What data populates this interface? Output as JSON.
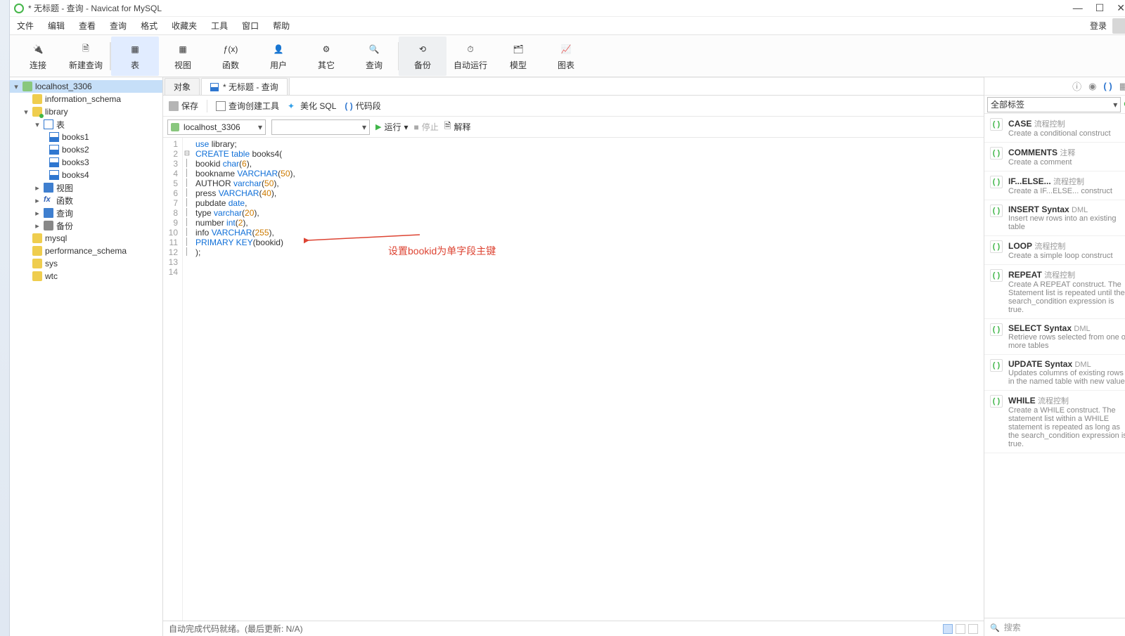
{
  "window": {
    "title": "* 无标题 - 查询 - Navicat for MySQL"
  },
  "win_controls": {
    "min": "—",
    "max": "☐",
    "close": "✕"
  },
  "menu": {
    "items": [
      "文件",
      "编辑",
      "查看",
      "查询",
      "格式",
      "收藏夹",
      "工具",
      "窗口",
      "帮助"
    ],
    "login": "登录"
  },
  "toolbar": {
    "items": [
      {
        "label": "连接",
        "icon": "plug"
      },
      {
        "label": "新建查询",
        "icon": "newq"
      },
      {
        "label": "表",
        "icon": "table",
        "active": true
      },
      {
        "label": "视图",
        "icon": "view"
      },
      {
        "label": "函数",
        "icon": "fx"
      },
      {
        "label": "用户",
        "icon": "user"
      },
      {
        "label": "其它",
        "icon": "other"
      },
      {
        "label": "查询",
        "icon": "query"
      },
      {
        "label": "备份",
        "icon": "backup",
        "grey": true
      },
      {
        "label": "自动运行",
        "icon": "auto"
      },
      {
        "label": "模型",
        "icon": "model"
      },
      {
        "label": "图表",
        "icon": "chart"
      }
    ]
  },
  "sidebar": {
    "conn": "localhost_3306",
    "dbs": [
      "information_schema"
    ],
    "library": {
      "name": "library",
      "tables_label": "表",
      "tables": [
        "books1",
        "books2",
        "books3",
        "books4"
      ],
      "view": "视图",
      "fx": "函数",
      "query": "查询",
      "backup": "备份"
    },
    "other_dbs": [
      "mysql",
      "performance_schema",
      "sys",
      "wtc"
    ]
  },
  "tabs": {
    "objects": "对象",
    "current": "* 无标题 - 查询"
  },
  "querybar": {
    "save": "保存",
    "builder": "查询创建工具",
    "beautify": "美化 SQL",
    "snippet": "代码段"
  },
  "connbar": {
    "conn": "localhost_3306",
    "run": "运行",
    "stop": "停止",
    "explain": "解释"
  },
  "code_lines": [
    [
      {
        "t": "use ",
        "c": "kw"
      },
      {
        "t": "library;"
      }
    ],
    [
      {
        "t": "CREATE table ",
        "c": "kw"
      },
      {
        "t": "books4("
      }
    ],
    [
      {
        "t": "bookid "
      },
      {
        "t": "char",
        "c": "kw"
      },
      {
        "t": "("
      },
      {
        "t": "6",
        "c": "num"
      },
      {
        "t": "),"
      }
    ],
    [
      {
        "t": "bookname "
      },
      {
        "t": "VARCHAR",
        "c": "kw"
      },
      {
        "t": "("
      },
      {
        "t": "50",
        "c": "num"
      },
      {
        "t": "),"
      }
    ],
    [
      {
        "t": "AUTHOR "
      },
      {
        "t": "varchar",
        "c": "kw"
      },
      {
        "t": "("
      },
      {
        "t": "50",
        "c": "num"
      },
      {
        "t": "),"
      }
    ],
    [
      {
        "t": "press "
      },
      {
        "t": "VARCHAR",
        "c": "kw"
      },
      {
        "t": "("
      },
      {
        "t": "40",
        "c": "num"
      },
      {
        "t": "),"
      }
    ],
    [
      {
        "t": "pubdate "
      },
      {
        "t": "date",
        "c": "kw"
      },
      {
        "t": ","
      }
    ],
    [
      {
        "t": "type "
      },
      {
        "t": "varchar",
        "c": "kw"
      },
      {
        "t": "("
      },
      {
        "t": "20",
        "c": "num"
      },
      {
        "t": "),"
      }
    ],
    [
      {
        "t": "number "
      },
      {
        "t": "int",
        "c": "kw"
      },
      {
        "t": "("
      },
      {
        "t": "2",
        "c": "num"
      },
      {
        "t": "),"
      }
    ],
    [
      {
        "t": "info "
      },
      {
        "t": "VARCHAR",
        "c": "kw"
      },
      {
        "t": "("
      },
      {
        "t": "255",
        "c": "num"
      },
      {
        "t": "),"
      }
    ],
    [
      {
        "t": "PRIMARY KEY",
        "c": "kw"
      },
      {
        "t": "(bookid)"
      }
    ],
    [
      {
        "t": ");"
      }
    ],
    [],
    []
  ],
  "annotation": "设置bookid为单字段主键",
  "status": "自动完成代码就绪。(最后更新: N/A)",
  "right": {
    "filter": "全部标签",
    "snippets": [
      {
        "name": "CASE",
        "sub": "流程控制",
        "desc": "Create a conditional construct"
      },
      {
        "name": "COMMENTS",
        "sub": "注释",
        "desc": "Create a comment"
      },
      {
        "name": "IF...ELSE...",
        "sub": "流程控制",
        "desc": "Create a IF...ELSE... construct"
      },
      {
        "name": "INSERT Syntax",
        "sub": "DML",
        "desc": "Insert new rows into an existing table"
      },
      {
        "name": "LOOP",
        "sub": "流程控制",
        "desc": "Create a simple loop construct"
      },
      {
        "name": "REPEAT",
        "sub": "流程控制",
        "desc": "Create A REPEAT construct. The Statement list is repeated until the search_condition expression is true."
      },
      {
        "name": "SELECT Syntax",
        "sub": "DML",
        "desc": "Retrieve rows selected from one or more tables"
      },
      {
        "name": "UPDATE Syntax",
        "sub": "DML",
        "desc": "Updates columns of existing rows in the named table with new values"
      },
      {
        "name": "WHILE",
        "sub": "流程控制",
        "desc": "Create a WHILE construct. The statement list within a WHILE statement is repeated as long as the search_condition expression is true."
      }
    ],
    "search": "搜索"
  }
}
